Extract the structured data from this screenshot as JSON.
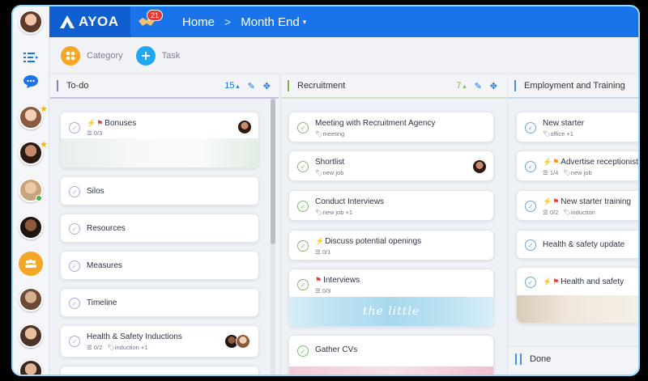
{
  "app": {
    "logo_text": "AYOA",
    "notification_count": "21"
  },
  "breadcrumb": {
    "home": "Home",
    "separator": ">",
    "board": "Month End",
    "caret": "▾"
  },
  "toolbar": {
    "category_label": "Category",
    "task_label": "Task"
  },
  "colors": {
    "topbar": "#1a73e8",
    "todo_accent": "#8e7cc3",
    "recruitment_accent": "#7cb342",
    "employment_accent": "#4a90d9",
    "category_orange": "#f5a623"
  },
  "columns": [
    {
      "title": "To-do",
      "count": "15",
      "count_caret": "▴",
      "cards": [
        {
          "title": "Bonuses",
          "meta": "0/3",
          "icons": "⚡🚩"
        },
        {
          "title": "Silos"
        },
        {
          "title": "Resources"
        },
        {
          "title": "Measures"
        },
        {
          "title": "Timeline"
        },
        {
          "title": "Health & Safety Inductions",
          "meta": "0/2",
          "tag": "induction",
          "extra": "+1"
        }
      ]
    },
    {
      "title": "Recruitment",
      "count": "7",
      "count_caret": "▴",
      "cards": [
        {
          "title": "Meeting with Recruitment Agency",
          "tag": "meeting"
        },
        {
          "title": "Shortlist",
          "tag": "new job"
        },
        {
          "title": "Conduct Interviews",
          "tag": "new job",
          "extra": "+1"
        },
        {
          "title": "Discuss potential openings",
          "meta": "0/1"
        },
        {
          "title": "Interviews",
          "meta": "0/3",
          "image_text": "the little"
        },
        {
          "title": "Gather CVs"
        }
      ]
    },
    {
      "title": "Employment and Training",
      "cards": [
        {
          "title": "New starter",
          "tag": "office",
          "extra": "+1"
        },
        {
          "title": "Advertise receptionist",
          "meta": "1/4",
          "tag": "new job"
        },
        {
          "title": "New starter training",
          "meta": "0/2",
          "tag": "induction"
        },
        {
          "title": "Health & safety update"
        },
        {
          "title": "Health and safety"
        }
      ],
      "done_label": "Done"
    }
  ]
}
